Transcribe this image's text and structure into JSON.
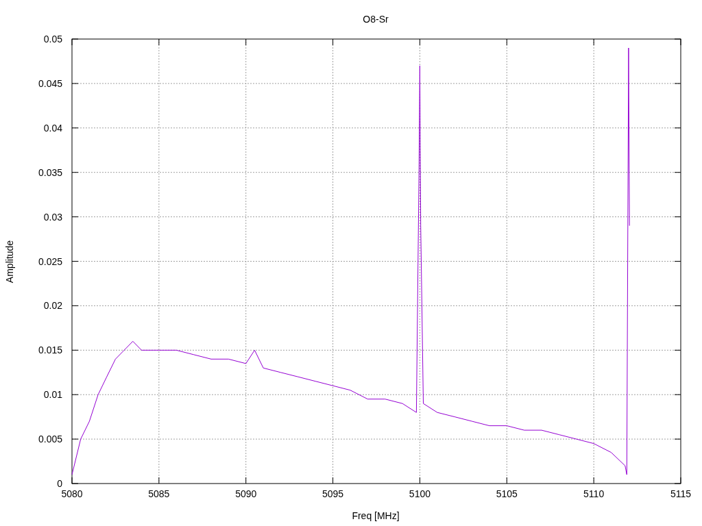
{
  "chart": {
    "chart_data": {
      "type": "line",
      "title": "O8-Sr",
      "xlabel": "Freq [MHz]",
      "ylabel": "Amplitude",
      "xlim": [
        5080,
        5115
      ],
      "ylim": [
        0,
        0.05
      ],
      "grid": true,
      "xticks": [
        5080,
        5085,
        5090,
        5095,
        5100,
        5105,
        5110,
        5115
      ],
      "yticks": [
        0,
        0.005,
        0.01,
        0.015,
        0.02,
        0.025,
        0.03,
        0.035,
        0.04,
        0.045,
        0.05
      ],
      "x": [
        5080,
        5080.5,
        5081,
        5081.5,
        5082,
        5082.5,
        5083,
        5083.5,
        5084,
        5085,
        5086,
        5087,
        5088,
        5089,
        5090,
        5090.5,
        5091,
        5092,
        5093,
        5094,
        5095,
        5096,
        5097,
        5098,
        5099,
        5099.8,
        5099.95,
        5100,
        5100.05,
        5100.2,
        5101,
        5102,
        5103,
        5104,
        5105,
        5106,
        5107,
        5108,
        5109,
        5110,
        5111,
        5111.8,
        5111.9,
        5112,
        5112.05
      ],
      "series": [
        {
          "color": "#9400d3",
          "values": [
            0.001,
            0.005,
            0.007,
            0.01,
            0.012,
            0.014,
            0.015,
            0.016,
            0.015,
            0.015,
            0.015,
            0.0145,
            0.014,
            0.014,
            0.0135,
            0.015,
            0.013,
            0.0125,
            0.012,
            0.0115,
            0.011,
            0.0105,
            0.0095,
            0.0095,
            0.009,
            0.008,
            0.035,
            0.047,
            0.029,
            0.009,
            0.008,
            0.0075,
            0.007,
            0.0065,
            0.0065,
            0.006,
            0.006,
            0.0055,
            0.005,
            0.0045,
            0.0035,
            0.002,
            0.001,
            0.049,
            0.029
          ]
        }
      ]
    }
  }
}
